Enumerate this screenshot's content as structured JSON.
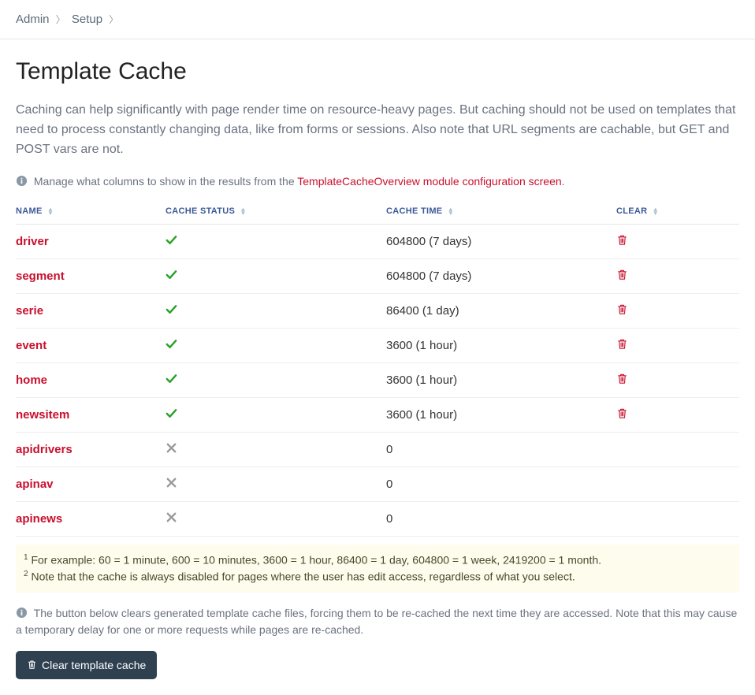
{
  "breadcrumb": {
    "admin": "Admin",
    "setup": "Setup"
  },
  "title": "Template Cache",
  "intro": "Caching can help significantly with page render time on resource-heavy pages. But caching should not be used on templates that need to process constantly changing data, like from forms or sessions. Also note that URL segments are cachable, but GET and POST vars are not.",
  "columns_info_prefix": "Manage what columns to show in the results from the ",
  "columns_info_link": "TemplateCacheOverview module configuration screen",
  "columns_info_suffix": ".",
  "headers": {
    "name": "NAME",
    "status": "CACHE STATUS",
    "time": "CACHE TIME",
    "clear": "CLEAR"
  },
  "rows": [
    {
      "name": "driver",
      "status": true,
      "time": "604800 (7 days)",
      "clearable": true
    },
    {
      "name": "segment",
      "status": true,
      "time": "604800 (7 days)",
      "clearable": true
    },
    {
      "name": "serie",
      "status": true,
      "time": "86400 (1 day)",
      "clearable": true
    },
    {
      "name": "event",
      "status": true,
      "time": "3600 (1 hour)",
      "clearable": true
    },
    {
      "name": "home",
      "status": true,
      "time": "3600 (1 hour)",
      "clearable": true
    },
    {
      "name": "newsitem",
      "status": true,
      "time": "3600 (1 hour)",
      "clearable": true
    },
    {
      "name": "apidrivers",
      "status": false,
      "time": "0",
      "clearable": false
    },
    {
      "name": "apinav",
      "status": false,
      "time": "0",
      "clearable": false
    },
    {
      "name": "apinews",
      "status": false,
      "time": "0",
      "clearable": false
    }
  ],
  "footnote1": "For example: 60 = 1 minute, 600 = 10 minutes, 3600 = 1 hour, 86400 = 1 day, 604800 = 1 week, 2419200 = 1 month.",
  "footnote2": "Note that the cache is always disabled for pages where the user has edit access, regardless of what you select.",
  "clear_note": "The button below clears generated template cache files, forcing them to be re-cached the next time they are accessed. Note that this may cause a temporary delay for one or more requests while pages are re-cached.",
  "clear_button": "Clear template cache"
}
